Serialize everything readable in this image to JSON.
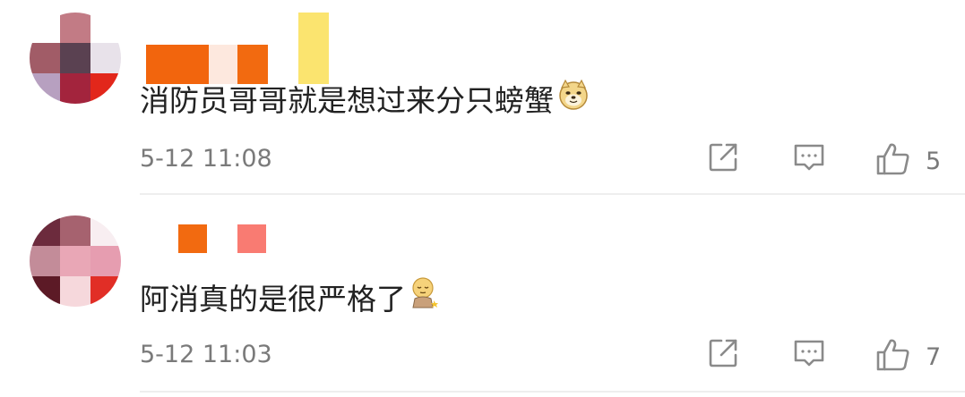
{
  "comments": [
    {
      "text": "消防员哥哥就是想过来分只螃蟹",
      "emoji": "doge-icon",
      "time": "5-12 11:08",
      "likes": "5",
      "avatar_colors": [
        "#ffffff",
        "#c27b85",
        "#ffffff",
        "#a15c67",
        "#5a4151",
        "#e8e2ea",
        "#b7a0c0",
        "#a3243d",
        "#e2271b"
      ],
      "name_colors": [
        "#f2650d",
        "#fde8de",
        "#f26a10",
        "#fbe46f"
      ]
    },
    {
      "text": "阿消真的是很严格了",
      "emoji": "doze-icon",
      "time": "5-12 11:03",
      "likes": "7",
      "avatar_colors": [
        "#6c2b3d",
        "#a6626f",
        "#f8eef1",
        "#c38c99",
        "#e9a7b6",
        "#e69db0",
        "#5c1a26",
        "#f6d8dc",
        "#e12e26"
      ],
      "name_colors": [
        "#f26a10",
        "#f97b72"
      ]
    }
  ],
  "actions": {
    "share_icon": "share-icon",
    "reply_icon": "comment-icon",
    "like_icon": "thumbs-up-icon"
  }
}
